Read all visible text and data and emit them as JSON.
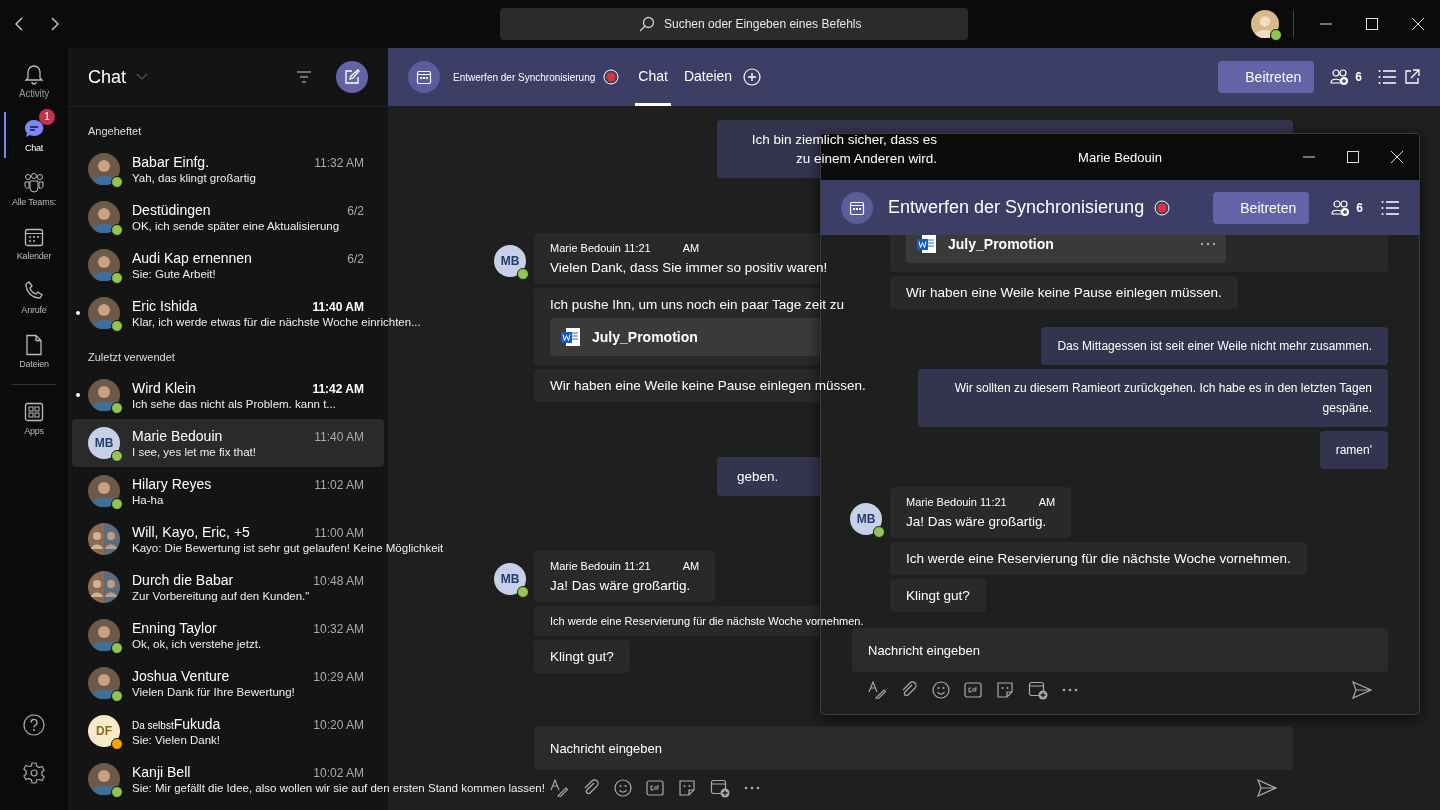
{
  "top_bar": {
    "search": {
      "placeholder": "Suchen oder Eingeben eines Befehls"
    },
    "profile": {
      "avatar": {
        "kind": "photo"
      },
      "away": false
    }
  },
  "rail": {
    "items": [
      {
        "kind": "activity",
        "label": "Activity",
        "selected": false
      },
      {
        "kind": "chat",
        "label": "Chat",
        "selected": true,
        "badge": "1"
      },
      {
        "kind": "teams",
        "label": "Alle Teams:",
        "selected": false
      },
      {
        "kind": "calendar",
        "label": "Kalender",
        "selected": false
      },
      {
        "kind": "calls",
        "label": "Anrufe",
        "selected": false
      },
      {
        "kind": "files",
        "label": "Dateien",
        "selected": false
      },
      {
        "kind": "apps",
        "label": "Apps",
        "selected": false
      }
    ]
  },
  "chat_list": {
    "title": "Chat",
    "sections": [
      {
        "title": "Angeheftet",
        "rows": [
          {
            "name": "Babar Einfg.",
            "time": "11:32 AM",
            "preview": "Yah, das klingt großartig",
            "avatar": {
              "kind": "photo"
            },
            "away": false,
            "unread": false,
            "selected": false
          },
          {
            "name": "Destüdingen",
            "time": "6/2",
            "preview": "OK, ich sende später eine Aktualisierung",
            "avatar": {
              "kind": "photo"
            },
            "away": false,
            "unread": false,
            "selected": false
          },
          {
            "name": "Audi Kap ernennen",
            "time": "6/2",
            "preview": "Sie: Gute Arbeit!",
            "avatar": {
              "kind": "photo"
            },
            "away": false,
            "unread": false,
            "selected": false
          },
          {
            "name": "Eric Ishida",
            "time": "11:40 AM",
            "preview": "Klar, ich werde etwas für die nächste Woche einrichten...",
            "avatar": {
              "kind": "photo"
            },
            "away": false,
            "unread": true,
            "selected": false
          }
        ]
      },
      {
        "title": "Zuletzt verwendet",
        "rows": [
          {
            "name": "Wird Klein",
            "time": "11:42 AM",
            "preview": "Ich sehe das nicht als Problem. kann t...",
            "avatar": {
              "kind": "photo"
            },
            "away": false,
            "unread": true,
            "selected": false
          },
          {
            "name": "Marie Bedouin",
            "time": "11:40 AM",
            "preview": "I see, yes let me fix that!",
            "avatar": {
              "kind": "initials",
              "initials": "MB"
            },
            "away": false,
            "unread": false,
            "selected": true
          },
          {
            "name": "Hilary Reyes",
            "time": "11:02 AM",
            "preview": "Ha-ha",
            "avatar": {
              "kind": "photo"
            },
            "away": false,
            "unread": false,
            "selected": false
          },
          {
            "name": "Will, Kayo, Eric, +5",
            "time": "11:00 AM",
            "preview": "Kayo: Die Bewertung ist sehr gut gelaufen! Keine Möglichkeit",
            "avatar": {
              "kind": "group"
            },
            "unread": false,
            "selected": false
          },
          {
            "name": "Durch die Babar",
            "time": "10:48 AM",
            "preview": "Zur Vorbereitung auf den Kunden.\"",
            "avatar": {
              "kind": "group"
            },
            "unread": false,
            "selected": false
          },
          {
            "name": "Enning Taylor",
            "time": "10:32 AM",
            "preview": "Ok, ok, ich verstehe jetzt.",
            "avatar": {
              "kind": "photo"
            },
            "away": false,
            "unread": false,
            "selected": false
          },
          {
            "name": "Joshua Venture",
            "time": "10:29 AM",
            "preview": "Vielen Dank für Ihre Bewertung!",
            "avatar": {
              "kind": "photo"
            },
            "away": false,
            "unread": false,
            "selected": false
          },
          {
            "name_prefix": "Da selbst",
            "name": "Fukuda",
            "time": "10:20 AM",
            "preview": "Sie: Vielen Dank!",
            "avatar": {
              "kind": "initials",
              "initials": "DF"
            },
            "away": true,
            "unread": false,
            "selected": false
          },
          {
            "name": "Kanji Bell",
            "time": "10:02 AM",
            "preview": "Sie: Mir gefällt die Idee, also wollen wir sie auf den ersten Stand kommen lassen!",
            "avatar": {
              "kind": "photo"
            },
            "away": false,
            "unread": false,
            "selected": false
          }
        ]
      }
    ]
  },
  "header": {
    "title": "Entwerfen der Synchronisierung",
    "recording": true,
    "tabs": [
      {
        "label": "Chat",
        "selected": true
      },
      {
        "label": "Dateien",
        "selected": false
      }
    ],
    "join_button": "Beitreten",
    "participants": "6"
  },
  "conversation": {
    "items": [
      {
        "kind": "own",
        "text": "Ich bin ziemlich sicher, dass es zu einem Anderen wird."
      },
      {
        "kind": "group",
        "sender": "Marie Bedouin",
        "time": "11:21",
        "suffix": "AM",
        "initials": "MB",
        "away": false,
        "messages": [
          {
            "kind": "text",
            "text": "Vielen Dank, dass Sie immer so positiv waren!"
          },
          {
            "kind": "file",
            "text": "Ich pushe Ihn, um uns noch ein paar Tage zeit zu",
            "file_name": "July_Promotion"
          },
          {
            "kind": "text",
            "text": "Wir haben eine Weile keine Pause einlegen müssen."
          }
        ]
      },
      {
        "kind": "own",
        "text": "geben."
      },
      {
        "kind": "group",
        "sender": "Marie Bedouin",
        "time": "11:21",
        "suffix": "AM",
        "initials": "MB",
        "away": false,
        "messages": [
          {
            "kind": "text",
            "text": "Ja! Das wäre großartig."
          },
          {
            "kind": "text",
            "text": "Ich werde eine Reservierung für die nächste Woche vornehmen."
          },
          {
            "kind": "text",
            "text": "Klingt gut?"
          }
        ]
      }
    ],
    "composer": {
      "placeholder": "Nachricht eingeben"
    }
  },
  "popout": {
    "title": "Marie Bedouin",
    "header": {
      "title": "Entwerfen der Synchronisierung",
      "recording": true,
      "join_button": "Beitreten",
      "participants": "6"
    },
    "items": [
      {
        "kind": "group",
        "messages": [
          {
            "kind": "file",
            "file_name": "July_Promotion"
          },
          {
            "kind": "text",
            "text": "Wir haben eine Weile keine Pause einlegen müssen."
          }
        ]
      },
      {
        "kind": "own",
        "text": "Das Mittagessen ist seit einer Weile nicht mehr zusammen."
      },
      {
        "kind": "own",
        "text": "Wir sollten zu diesem Ramieort zurückgehen. Ich habe es in den letzten Tagen gespäne."
      },
      {
        "kind": "own",
        "text": "ramen'"
      },
      {
        "kind": "group",
        "sender": "Marie Bedouin",
        "time": "11:21",
        "suffix": "AM",
        "initials": "MB",
        "away": false,
        "messages": [
          {
            "kind": "text",
            "text": "Ja! Das wäre großartig."
          },
          {
            "kind": "text",
            "text": "Ich werde eine Reservierung für die nächste Woche vornehmen."
          },
          {
            "kind": "text",
            "text": "Klingt gut?"
          }
        ]
      }
    ],
    "composer": {
      "placeholder": "Nachricht eingeben"
    }
  }
}
